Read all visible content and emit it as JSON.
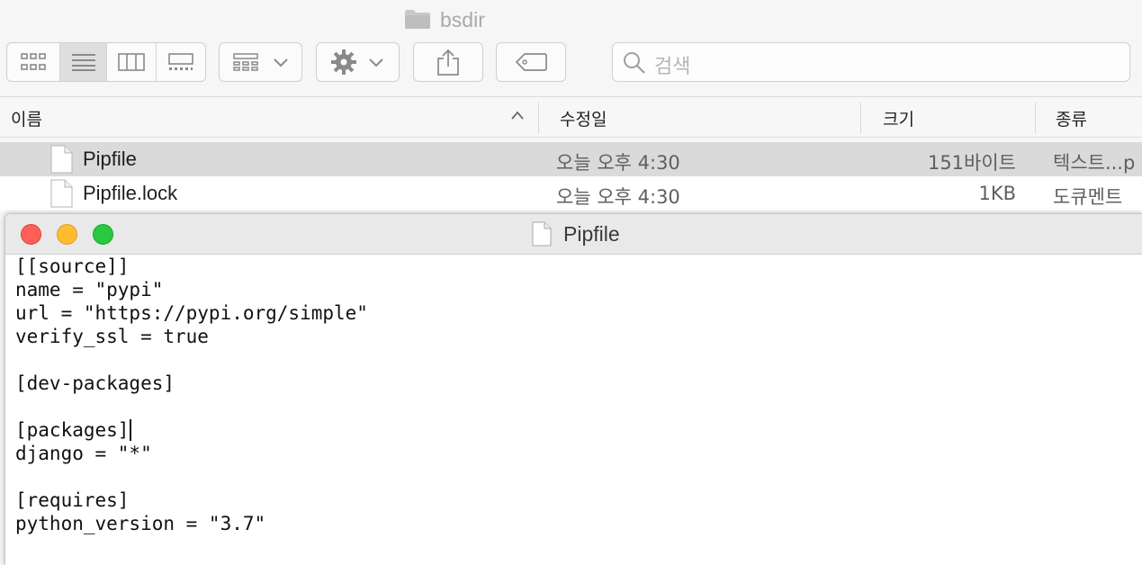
{
  "finder": {
    "title": "bsdir",
    "search_placeholder": "검색",
    "columns": {
      "name": "이름",
      "modified": "수정일",
      "size": "크기",
      "kind": "종류"
    },
    "files": [
      {
        "name": "Pipfile",
        "modified": "오늘 오후 4:30",
        "size": "151바이트",
        "kind": "텍스트...p",
        "selected": true
      },
      {
        "name": "Pipfile.lock",
        "modified": "오늘 오후 4:30",
        "size": "1KB",
        "kind": "도큐멘트",
        "selected": false
      }
    ],
    "view_modes": [
      "icon-view-icon",
      "list-view-icon",
      "column-view-icon",
      "gallery-view-icon"
    ],
    "active_view": "list-view-icon"
  },
  "textedit": {
    "title": "Pipfile",
    "lines": [
      "[[source]]",
      "name = \"pypi\"",
      "url = \"https://pypi.org/simple\"",
      "verify_ssl = true",
      "",
      "[dev-packages]",
      "",
      "[packages]",
      "django = \"*\"",
      "",
      "[requires]",
      "python_version = \"3.7\""
    ],
    "caret_line": 7
  },
  "colors": {
    "close": "#fe5f57",
    "minimize": "#febc2e",
    "zoom": "#28c840",
    "selected_row": "#dadada"
  }
}
